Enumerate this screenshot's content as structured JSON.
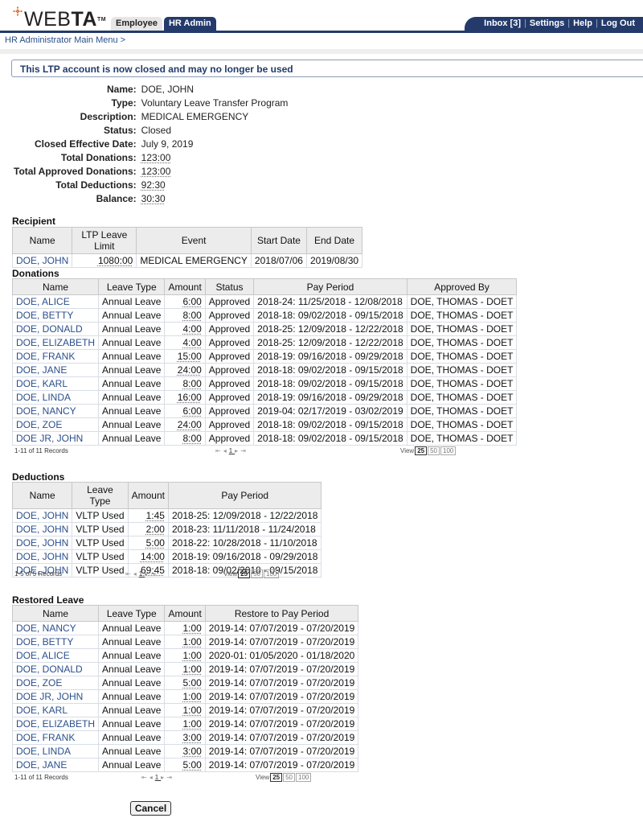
{
  "header": {
    "logo_text_light": "WEB",
    "logo_text_bold": "TA",
    "logo_tm": "TM",
    "logo_dot_color": "#e2682a",
    "tabs": [
      {
        "label": "Employee",
        "active": false
      },
      {
        "label": "HR Admin",
        "active": true
      }
    ],
    "topnav": {
      "inbox": "Inbox [3]",
      "settings": "Settings",
      "help": "Help",
      "logout": "Log Out",
      "separator": "|"
    },
    "brand_color": "#243a6b"
  },
  "breadcrumb": "HR Administrator Main Menu >",
  "alert": "This LTP account is now closed and may no longer be used",
  "summary": [
    {
      "label": "Name:",
      "value": "DOE, JOHN",
      "dotted": false
    },
    {
      "label": "Type:",
      "value": "Voluntary Leave Transfer Program",
      "dotted": false
    },
    {
      "label": "Description:",
      "value": "MEDICAL EMERGENCY",
      "dotted": false
    },
    {
      "label": "Status:",
      "value": "Closed",
      "dotted": false
    },
    {
      "label": "Closed Effective Date:",
      "value": "July 9, 2019",
      "dotted": false
    },
    {
      "label": "Total Donations:",
      "value": "123:00",
      "dotted": true
    },
    {
      "label": "Total Approved Donations:",
      "value": "123:00",
      "dotted": true
    },
    {
      "label": "Total Deductions:",
      "value": "92:30",
      "dotted": true
    },
    {
      "label": "Balance:",
      "value": "30:30",
      "dotted": true
    }
  ],
  "recipient": {
    "title": "Recipient",
    "columns": [
      "Name",
      "LTP Leave Limit",
      "Event",
      "Start Date",
      "End Date"
    ],
    "rows": [
      [
        "DOE, JOHN",
        "1080:00",
        "MEDICAL EMERGENCY",
        "2018/07/06",
        "2019/08/30"
      ]
    ]
  },
  "donations": {
    "title": "Donations",
    "columns": [
      "Name",
      "Leave Type",
      "Amount",
      "Status",
      "Pay Period",
      "Approved By"
    ],
    "rows": [
      [
        "DOE, ALICE",
        "Annual Leave",
        "6:00",
        "Approved",
        "2018-24: 11/25/2018 - 12/08/2018",
        "DOE, THOMAS - DOET"
      ],
      [
        "DOE, BETTY",
        "Annual Leave",
        "8:00",
        "Approved",
        "2018-18: 09/02/2018 - 09/15/2018",
        "DOE, THOMAS - DOET"
      ],
      [
        "DOE, DONALD",
        "Annual Leave",
        "4:00",
        "Approved",
        "2018-25: 12/09/2018 - 12/22/2018",
        "DOE, THOMAS - DOET"
      ],
      [
        "DOE, ELIZABETH",
        "Annual Leave",
        "4:00",
        "Approved",
        "2018-25: 12/09/2018 - 12/22/2018",
        "DOE, THOMAS - DOET"
      ],
      [
        "DOE, FRANK",
        "Annual Leave",
        "15:00",
        "Approved",
        "2018-19: 09/16/2018 - 09/29/2018",
        "DOE, THOMAS - DOET"
      ],
      [
        "DOE, JANE",
        "Annual Leave",
        "24:00",
        "Approved",
        "2018-18: 09/02/2018 - 09/15/2018",
        "DOE, THOMAS - DOET"
      ],
      [
        "DOE, KARL",
        "Annual Leave",
        "8:00",
        "Approved",
        "2018-18: 09/02/2018 - 09/15/2018",
        "DOE, THOMAS - DOET"
      ],
      [
        "DOE, LINDA",
        "Annual Leave",
        "16:00",
        "Approved",
        "2018-19: 09/16/2018 - 09/29/2018",
        "DOE, THOMAS - DOET"
      ],
      [
        "DOE, NANCY",
        "Annual Leave",
        "6:00",
        "Approved",
        "2019-04: 02/17/2019 - 03/02/2019",
        "DOE, THOMAS - DOET"
      ],
      [
        "DOE, ZOE",
        "Annual Leave",
        "24:00",
        "Approved",
        "2018-18: 09/02/2018 - 09/15/2018",
        "DOE, THOMAS - DOET"
      ],
      [
        "DOE JR, JOHN",
        "Annual Leave",
        "8:00",
        "Approved",
        "2018-18: 09/02/2018 - 09/15/2018",
        "DOE, THOMAS - DOET"
      ]
    ],
    "records": "1-11 of 11 Records"
  },
  "deductions": {
    "title": "Deductions",
    "columns": [
      "Name",
      "Leave Type",
      "Amount",
      "Pay Period"
    ],
    "rows": [
      [
        "DOE, JOHN",
        "VLTP Used",
        "1:45",
        "2018-25: 12/09/2018 - 12/22/2018"
      ],
      [
        "DOE, JOHN",
        "VLTP Used",
        "2:00",
        "2018-23: 11/11/2018 - 11/24/2018"
      ],
      [
        "DOE, JOHN",
        "VLTP Used",
        "5:00",
        "2018-22: 10/28/2018 - 11/10/2018"
      ],
      [
        "DOE, JOHN",
        "VLTP Used",
        "14:00",
        "2018-19: 09/16/2018 - 09/29/2018"
      ],
      [
        "DOE, JOHN",
        "VLTP Used",
        "69:45",
        "2018-18: 09/02/2018 - 09/15/2018"
      ]
    ],
    "records": "1-5 of 5 Records"
  },
  "restored": {
    "title": "Restored Leave",
    "columns": [
      "Name",
      "Leave Type",
      "Amount",
      "Restore to Pay Period"
    ],
    "rows": [
      [
        "DOE, NANCY",
        "Annual Leave",
        "1:00",
        "2019-14: 07/07/2019 - 07/20/2019"
      ],
      [
        "DOE, BETTY",
        "Annual Leave",
        "1:00",
        "2019-14: 07/07/2019 - 07/20/2019"
      ],
      [
        "DOE, ALICE",
        "Annual Leave",
        "1:00",
        "2020-01: 01/05/2020 - 01/18/2020"
      ],
      [
        "DOE, DONALD",
        "Annual Leave",
        "1:00",
        "2019-14: 07/07/2019 - 07/20/2019"
      ],
      [
        "DOE, ZOE",
        "Annual Leave",
        "5:00",
        "2019-14: 07/07/2019 - 07/20/2019"
      ],
      [
        "DOE JR, JOHN",
        "Annual Leave",
        "1:00",
        "2019-14: 07/07/2019 - 07/20/2019"
      ],
      [
        "DOE, KARL",
        "Annual Leave",
        "1:00",
        "2019-14: 07/07/2019 - 07/20/2019"
      ],
      [
        "DOE, ELIZABETH",
        "Annual Leave",
        "1:00",
        "2019-14: 07/07/2019 - 07/20/2019"
      ],
      [
        "DOE, FRANK",
        "Annual Leave",
        "3:00",
        "2019-14: 07/07/2019 - 07/20/2019"
      ],
      [
        "DOE, LINDA",
        "Annual Leave",
        "3:00",
        "2019-14: 07/07/2019 - 07/20/2019"
      ],
      [
        "DOE, JANE",
        "Annual Leave",
        "5:00",
        "2019-14: 07/07/2019 - 07/20/2019"
      ]
    ],
    "records": "1-11 of 11 Records"
  },
  "pager": {
    "first": "⇤",
    "prev": "◂",
    "current_page": "1",
    "next": "▸",
    "last": "⇥",
    "view_label": "View",
    "view_options": [
      "25",
      "50",
      "100"
    ],
    "view_selected": "25"
  },
  "cancel_label": "Cancel"
}
